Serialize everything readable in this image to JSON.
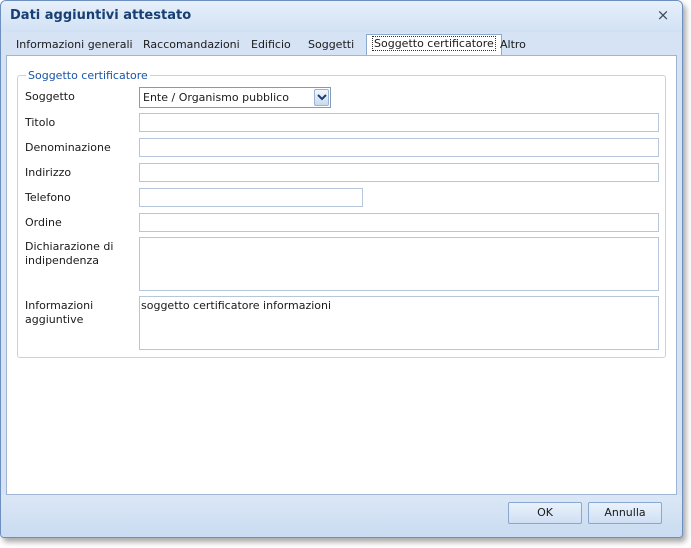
{
  "window": {
    "title": "Dati aggiuntivi attestato",
    "close_glyph": "×"
  },
  "tabs": [
    {
      "label": "Informazioni generali"
    },
    {
      "label": "Raccomandazioni"
    },
    {
      "label": "Edificio"
    },
    {
      "label": "Soggetti"
    },
    {
      "label": "Soggetto certificatore",
      "active": true
    },
    {
      "label": "Altro"
    }
  ],
  "group": {
    "title": "Soggetto certificatore",
    "fields": {
      "soggetto": {
        "label": "Soggetto",
        "value": "Ente / Organismo pubblico"
      },
      "titolo": {
        "label": "Titolo",
        "value": ""
      },
      "denominazione": {
        "label": "Denominazione",
        "value": ""
      },
      "indirizzo": {
        "label": "Indirizzo",
        "value": ""
      },
      "telefono": {
        "label": "Telefono",
        "value": ""
      },
      "ordine": {
        "label": "Ordine",
        "value": ""
      },
      "dichiarazione": {
        "label_line1": "Dichiarazione di",
        "label_line2": "indipendenza",
        "value": ""
      },
      "informazioni": {
        "label_line1": "Informazioni",
        "label_line2": "aggiuntive",
        "value": "soggetto certificatore informazioni"
      }
    }
  },
  "buttons": {
    "ok": "OK",
    "cancel": "Annulla"
  },
  "colors": {
    "title_text": "#173f73",
    "group_title": "#1a54a8",
    "chrome": "#d5e3f5"
  },
  "icons": {
    "close": "close-icon",
    "dropdown": "chevron-down-icon"
  }
}
